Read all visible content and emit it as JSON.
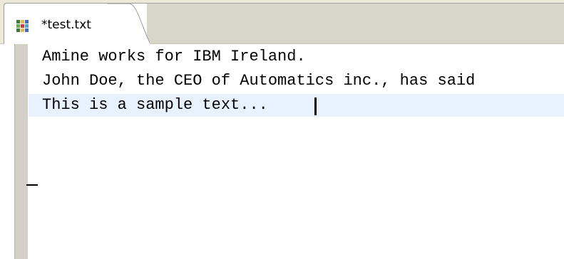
{
  "tab": {
    "label": "*test.txt",
    "icon": "text-file-icon",
    "close_icon": "close-icon",
    "icon_colors": [
      "#3b7f2e",
      "#e8b84a",
      "#3b6fc4",
      "#6fa843",
      "#c83b3b",
      "#5aa0d8",
      "#3b7f2e",
      "#e8b84a",
      "#3b6fc4"
    ]
  },
  "editor": {
    "lines": [
      "Amine works for IBM Ireland.",
      "John Doe, the CEO of Automatics inc., has said",
      "This is a sample text..."
    ],
    "current_line_color": "#e8f2fe"
  }
}
